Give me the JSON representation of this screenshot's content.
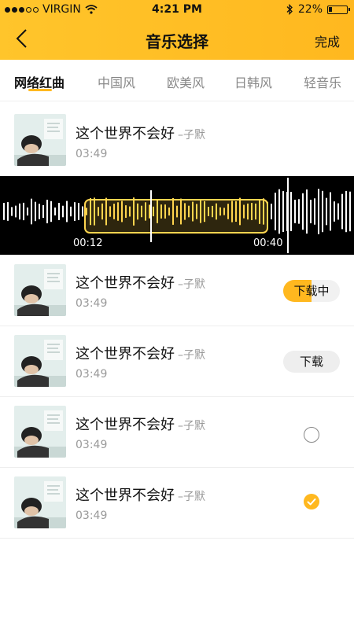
{
  "status": {
    "carrier": "VIRGIN",
    "time": "4:21 PM",
    "battery": "22%",
    "battery_level": 0.22
  },
  "nav": {
    "title": "音乐选择",
    "done": "完成"
  },
  "tabs": [
    "网络红曲",
    "中国风",
    "欧美风",
    "日韩风",
    "轻音乐"
  ],
  "active_tab": 0,
  "songs": [
    {
      "title": "这个世界不会好",
      "artist": "–子默",
      "duration": "03:49",
      "state": "playing"
    },
    {
      "title": "这个世界不会好",
      "artist": "–子默",
      "duration": "03:49",
      "state": "downloading",
      "action": "下载中",
      "progress": 0.5
    },
    {
      "title": "这个世界不会好",
      "artist": "–子默",
      "duration": "03:49",
      "state": "download",
      "action": "下载"
    },
    {
      "title": "这个世界不会好",
      "artist": "–子默",
      "duration": "03:49",
      "state": "unselected"
    },
    {
      "title": "这个世界不会好",
      "artist": "–子默",
      "duration": "03:49",
      "state": "selected"
    }
  ],
  "waveform": {
    "start": "00:12",
    "end": "00:40",
    "accent": "#ffd54f"
  },
  "colors": {
    "accent": "#ffb81f"
  }
}
